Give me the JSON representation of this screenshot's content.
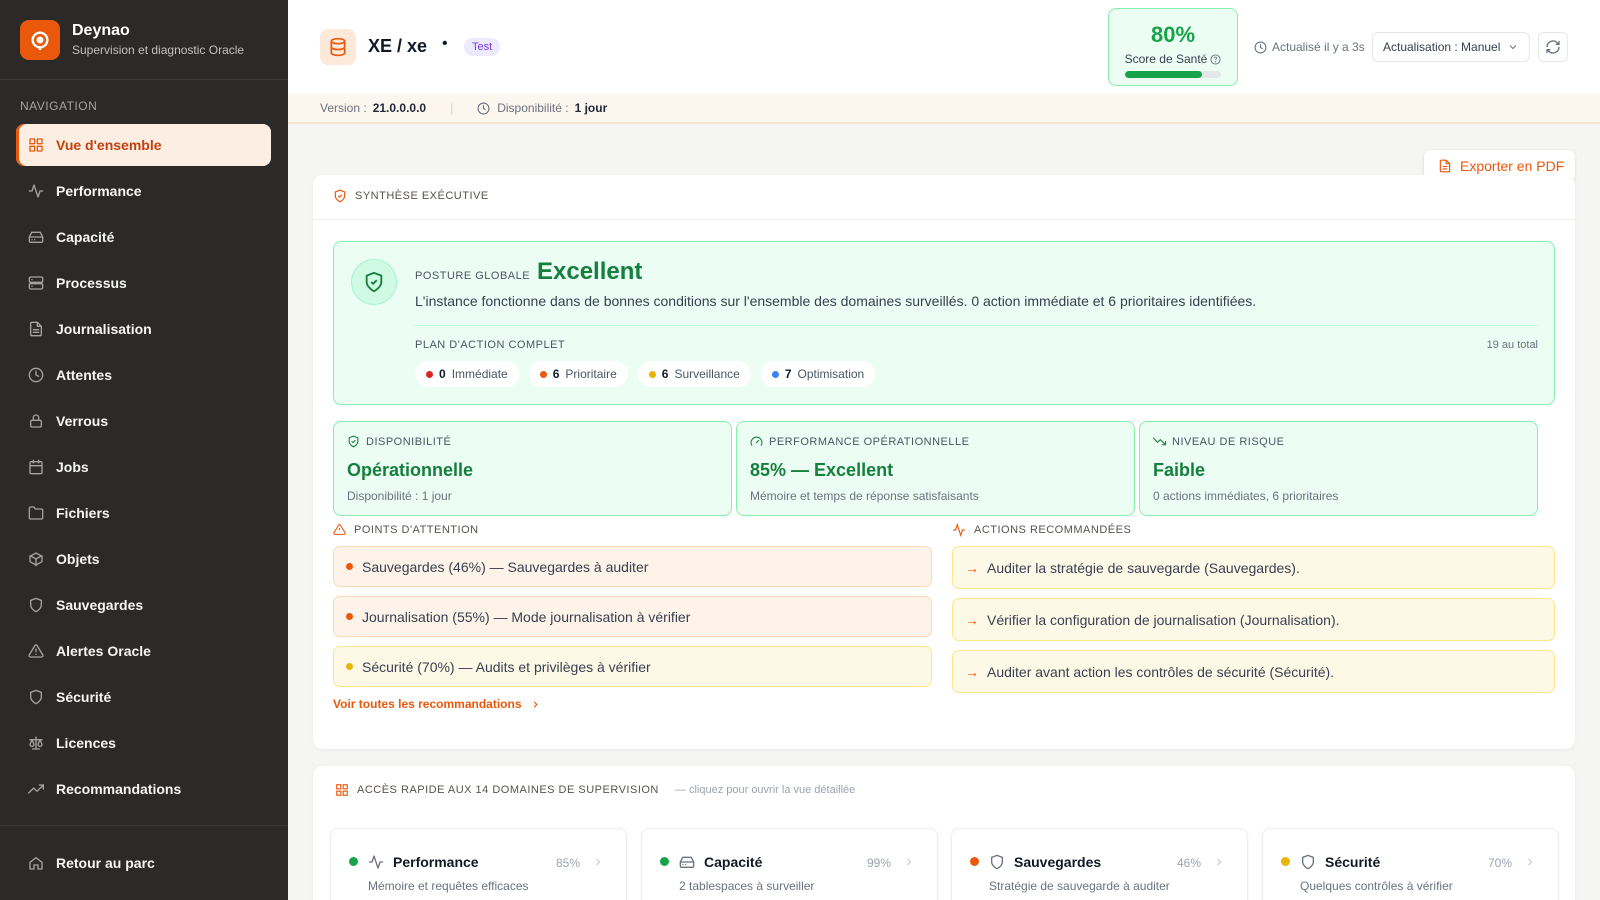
{
  "brand": {
    "name": "Deynao",
    "subtitle": "Supervision et diagnostic Oracle"
  },
  "sidebar": {
    "section_title": "NAVIGATION",
    "items": [
      {
        "label": "Vue d'ensemble",
        "icon": "grid-icon",
        "active": true
      },
      {
        "label": "Performance",
        "icon": "activity-icon"
      },
      {
        "label": "Capacité",
        "icon": "hard-drive-icon"
      },
      {
        "label": "Processus",
        "icon": "server-icon"
      },
      {
        "label": "Journalisation",
        "icon": "file-text-icon"
      },
      {
        "label": "Attentes",
        "icon": "clock-icon"
      },
      {
        "label": "Verrous",
        "icon": "lock-icon"
      },
      {
        "label": "Jobs",
        "icon": "calendar-icon"
      },
      {
        "label": "Fichiers",
        "icon": "folder-icon"
      },
      {
        "label": "Objets",
        "icon": "box-icon"
      },
      {
        "label": "Sauvegardes",
        "icon": "shield-icon"
      },
      {
        "label": "Alertes Oracle",
        "icon": "alert-triangle-icon"
      },
      {
        "label": "Sécurité",
        "icon": "shield-icon"
      },
      {
        "label": "Licences",
        "icon": "scale-icon"
      },
      {
        "label": "Recommandations",
        "icon": "trending-up-icon"
      }
    ],
    "bottom_link": "Retour au parc"
  },
  "header": {
    "instance_title": "XE / xe",
    "separator": "•",
    "env_badge": "Test",
    "health_score": "80%",
    "health_score_value": 80,
    "health_label": "Score de Santé",
    "refreshed_text": "Actualisé il y a 3s",
    "refresh_mode": "Actualisation : Manuel",
    "version_label": "Version :",
    "version_value": "21.0.0.0.0",
    "uptime_label": "Disponibilité :",
    "uptime_value": "1 jour"
  },
  "export_label": "Exporter en PDF",
  "executive": {
    "title": "SYNTHÈSE EXÉCUTIVE",
    "posture_label": "POSTURE GLOBALE",
    "posture_value": "Excellent",
    "posture_desc": "L'instance fonctionne dans de bonnes conditions sur l'ensemble des domaines surveillés. 0 action immédiate et 6 prioritaires identifiées.",
    "plan_label": "PLAN D'ACTION COMPLET",
    "plan_total": "19 au total",
    "plan_chips": [
      {
        "count": "0",
        "label": "Immédiate",
        "color": "#dc2626"
      },
      {
        "count": "6",
        "label": "Prioritaire",
        "color": "#ea580c"
      },
      {
        "count": "6",
        "label": "Surveillance",
        "color": "#eab308"
      },
      {
        "count": "7",
        "label": "Optimisation",
        "color": "#3b82f6"
      }
    ],
    "kpis": [
      {
        "label": "DISPONIBILITÉ",
        "value": "Opérationnelle",
        "sub": "Disponibilité : 1 jour",
        "icon": "shield-check-icon"
      },
      {
        "label": "PERFORMANCE OPÉRATIONNELLE",
        "value": "85% — Excellent",
        "sub": "Mémoire et temps de réponse satisfaisants",
        "icon": "gauge-icon"
      },
      {
        "label": "NIVEAU DE RISQUE",
        "value": "Faible",
        "sub": "0 actions immédiates, 6 prioritaires",
        "icon": "trending-down-icon"
      }
    ],
    "attention_title": "POINTS D'ATTENTION",
    "attention": [
      {
        "text": "Sauvegardes (46%) — Sauvegardes à auditer",
        "color": "#ea580c",
        "bg": "#fef3e8",
        "border": "#fdd9b5"
      },
      {
        "text": "Journalisation (55%) — Mode journalisation à vérifier",
        "color": "#ea580c",
        "bg": "#fef3e8",
        "border": "#fdd9b5"
      },
      {
        "text": "Sécurité (70%) — Audits et privilèges à vérifier",
        "color": "#eab308",
        "bg": "#fef9e7",
        "border": "#fde68a"
      }
    ],
    "actions_title": "ACTIONS RECOMMANDÉES",
    "actions": [
      {
        "text": "Auditer la stratégie de sauvegarde (Sauvegardes)."
      },
      {
        "text": "Vérifier la configuration de journalisation (Journalisation)."
      },
      {
        "text": "Auditer avant action les contrôles de sécurité (Sécurité)."
      }
    ],
    "see_all": "Voir toutes les recommandations"
  },
  "quick_access": {
    "title": "ACCÈS RAPIDE AUX 14 DOMAINES DE SUPERVISION",
    "hint": "— cliquez pour ouvrir la vue détaillée",
    "domains": [
      {
        "name": "Performance",
        "pct": "85%",
        "desc": "Mémoire et requêtes efficaces",
        "color": "#16a34a",
        "icon": "activity-icon"
      },
      {
        "name": "Capacité",
        "pct": "99%",
        "desc": "2 tablespaces à surveiller",
        "color": "#16a34a",
        "icon": "hard-drive-icon"
      },
      {
        "name": "Sauvegardes",
        "pct": "46%",
        "desc": "Stratégie de sauvegarde à auditer",
        "color": "#ea580c",
        "icon": "shield-icon"
      },
      {
        "name": "Sécurité",
        "pct": "70%",
        "desc": "Quelques contrôles à vérifier",
        "color": "#eab308",
        "icon": "shield-icon"
      }
    ]
  }
}
